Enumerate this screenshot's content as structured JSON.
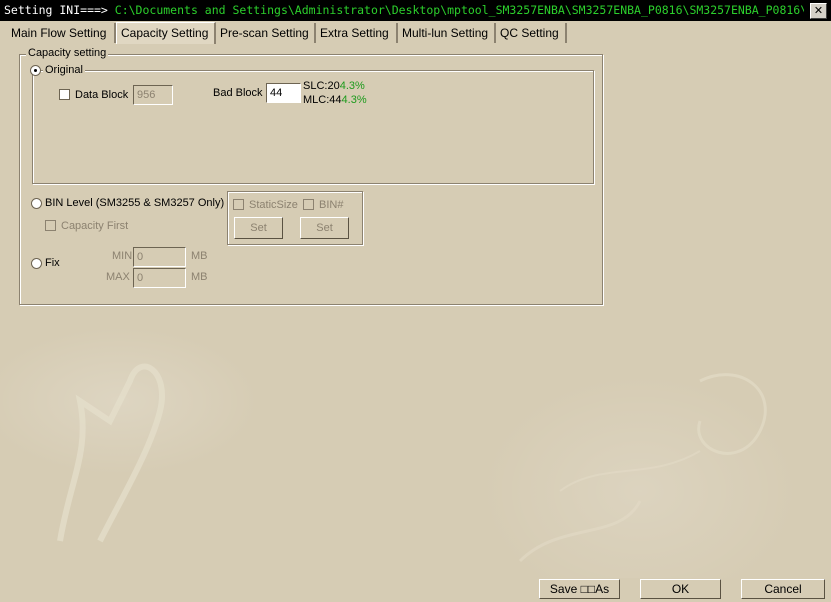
{
  "window": {
    "title_prefix": "Setting  INI===> ",
    "title_path": "C:\\Documents and Settings\\Administrator\\Desktop\\mptool_SM3257ENBA\\SM3257ENBA_P0816\\SM3257ENBA_P0816\\de..",
    "close_glyph": "✕"
  },
  "tabs": [
    {
      "label": "Main Flow Setting"
    },
    {
      "label": "Capacity Setting"
    },
    {
      "label": "Pre-scan Setting"
    },
    {
      "label": "Extra Setting"
    },
    {
      "label": "Multi-lun Setting"
    },
    {
      "label": "QC Setting"
    }
  ],
  "active_tab": "Capacity Setting",
  "capacity": {
    "group_label": "Capacity setting",
    "original_label": "Original",
    "original_selected": true,
    "data_block_label": "Data Block",
    "data_block_checked": false,
    "data_block_value": "956",
    "bad_block_label": "Bad Block",
    "bad_block_value": "44",
    "slc_label": "SLC:20",
    "slc_pct": "4.3%",
    "mlc_label": "MLC:44",
    "mlc_pct": "4.3%",
    "bin_level_label": "BIN Level (SM3255 & SM3257 Only)",
    "capacity_first_label": "Capacity First",
    "static_size_label": "StaticSize",
    "bin_num_label": "BIN#",
    "set_label_1": "Set",
    "set_label_2": "Set",
    "fix_label": "Fix",
    "min_label": "MIN",
    "min_value": "0",
    "min_unit": "MB",
    "max_label": "MAX",
    "max_value": "0",
    "max_unit": "MB"
  },
  "footer": {
    "save_as_label": "Save  □□As",
    "ok_label": "OK",
    "cancel_label": "Cancel"
  },
  "colors": {
    "background": "#d6ccb4",
    "title_path": "#2cd02c",
    "percent_green": "#1c9a1c"
  }
}
